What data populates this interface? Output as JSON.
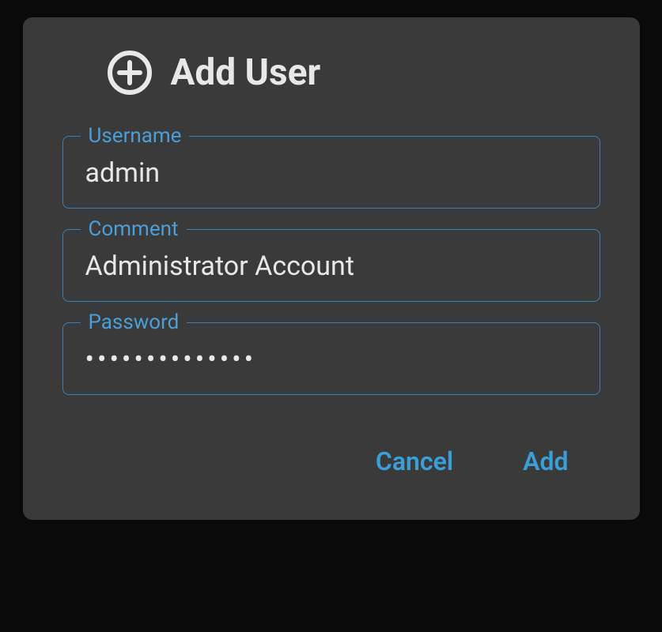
{
  "dialog": {
    "title": "Add User",
    "fields": {
      "username": {
        "label": "Username",
        "value": "admin"
      },
      "comment": {
        "label": "Comment",
        "value": "Administrator Account"
      },
      "password": {
        "label": "Password",
        "value": "••••••••••••••"
      }
    },
    "actions": {
      "cancel": "Cancel",
      "add": "Add"
    }
  }
}
